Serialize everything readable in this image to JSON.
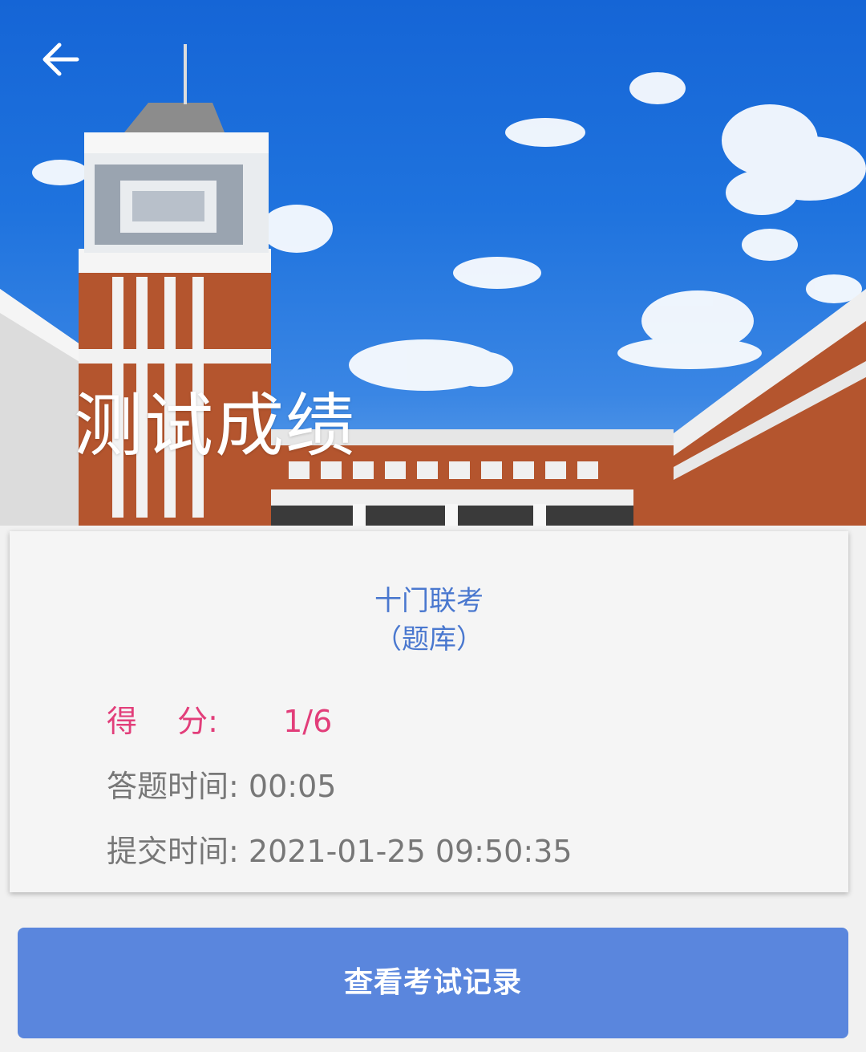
{
  "header": {
    "title": "测试成绩",
    "back_icon": "arrow-left-icon"
  },
  "result": {
    "exam_name": "十门联考",
    "exam_type": "（题库）",
    "score_label": "得　 分:",
    "score_value": "1/6",
    "duration_label": "答题时间:",
    "duration_value": "00:05",
    "submit_label": "提交时间:",
    "submit_value": "2021-01-25 09:50:35"
  },
  "actions": {
    "view_records_label": "查看考试记录"
  },
  "colors": {
    "accent_blue": "#4a78cf",
    "button_blue": "#5a86dd",
    "score_pink": "#e23e7a",
    "muted_grey": "#777777"
  }
}
